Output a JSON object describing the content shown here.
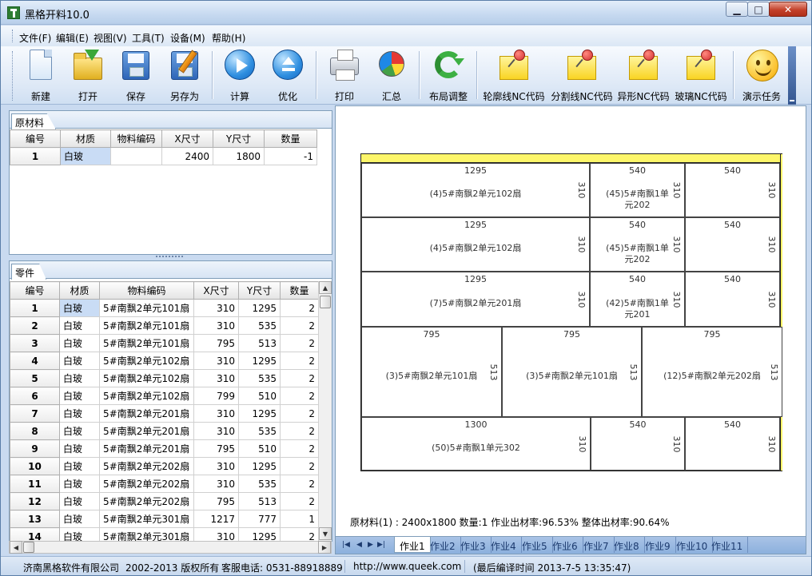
{
  "window": {
    "title": "黑格开料10.0"
  },
  "menu": [
    "文件(F)",
    "编辑(E)",
    "视图(V)",
    "工具(T)",
    "设备(M)",
    "帮助(H)"
  ],
  "toolbar": {
    "new": "新建",
    "open": "打开",
    "save": "保存",
    "save_as": "另存为",
    "compute": "计算",
    "optimize": "优化",
    "print": "打印",
    "summary": "汇总",
    "layout_adjust": "布局调整",
    "contour_nc": "轮廓线NC代码",
    "split_nc": "分割线NC代码",
    "shape_nc": "异形NC代码",
    "glass_nc": "玻璃NC代码",
    "demo_task": "演示任务"
  },
  "raw_panel": {
    "tab": "原材料",
    "headers": [
      "编号",
      "材质",
      "物料编码",
      "X尺寸",
      "Y尺寸",
      "数量"
    ],
    "rows": [
      {
        "id": "1",
        "material": "白玻",
        "code": "",
        "x": "2400",
        "y": "1800",
        "qty": "-1"
      }
    ]
  },
  "parts_panel": {
    "tab": "零件",
    "headers": [
      "编号",
      "材质",
      "物料编码",
      "X尺寸",
      "Y尺寸",
      "数量"
    ],
    "rows": [
      {
        "id": "1",
        "material": "白玻",
        "code": "5#南飘2单元101扇",
        "x": "310",
        "y": "1295",
        "qty": "2"
      },
      {
        "id": "2",
        "material": "白玻",
        "code": "5#南飘2单元101扇",
        "x": "310",
        "y": "535",
        "qty": "2"
      },
      {
        "id": "3",
        "material": "白玻",
        "code": "5#南飘2单元101扇",
        "x": "795",
        "y": "513",
        "qty": "2"
      },
      {
        "id": "4",
        "material": "白玻",
        "code": "5#南飘2单元102扇",
        "x": "310",
        "y": "1295",
        "qty": "2"
      },
      {
        "id": "5",
        "material": "白玻",
        "code": "5#南飘2单元102扇",
        "x": "310",
        "y": "535",
        "qty": "2"
      },
      {
        "id": "6",
        "material": "白玻",
        "code": "5#南飘2单元102扇",
        "x": "799",
        "y": "510",
        "qty": "2"
      },
      {
        "id": "7",
        "material": "白玻",
        "code": "5#南飘2单元201扇",
        "x": "310",
        "y": "1295",
        "qty": "2"
      },
      {
        "id": "8",
        "material": "白玻",
        "code": "5#南飘2单元201扇",
        "x": "310",
        "y": "535",
        "qty": "2"
      },
      {
        "id": "9",
        "material": "白玻",
        "code": "5#南飘2单元201扇",
        "x": "795",
        "y": "510",
        "qty": "2"
      },
      {
        "id": "10",
        "material": "白玻",
        "code": "5#南飘2单元202扇",
        "x": "310",
        "y": "1295",
        "qty": "2"
      },
      {
        "id": "11",
        "material": "白玻",
        "code": "5#南飘2单元202扇",
        "x": "310",
        "y": "535",
        "qty": "2"
      },
      {
        "id": "12",
        "material": "白玻",
        "code": "5#南飘2单元202扇",
        "x": "795",
        "y": "513",
        "qty": "2"
      },
      {
        "id": "13",
        "material": "白玻",
        "code": "5#南飘2单元301扇",
        "x": "1217",
        "y": "777",
        "qty": "1"
      },
      {
        "id": "14",
        "material": "白玻",
        "code": "5#南飘2单元301扇",
        "x": "310",
        "y": "1295",
        "qty": "2"
      }
    ]
  },
  "layout": {
    "parts": [
      {
        "w": "1295",
        "h": "310",
        "name": "(4)5#南飘2单元102扇"
      },
      {
        "w": "540",
        "h": "310",
        "name": "(45)5#南飘1单元202"
      },
      {
        "w": "540",
        "h": "310",
        "name": ""
      },
      {
        "w": "1295",
        "h": "310",
        "name": "(4)5#南飘2单元102扇"
      },
      {
        "w": "540",
        "h": "310",
        "name": "(45)5#南飘1单元202"
      },
      {
        "w": "540",
        "h": "310",
        "name": ""
      },
      {
        "w": "1295",
        "h": "310",
        "name": "(7)5#南飘2单元201扇"
      },
      {
        "w": "540",
        "h": "310",
        "name": "(42)5#南飘1单元201"
      },
      {
        "w": "540",
        "h": "310",
        "name": ""
      },
      {
        "w": "795",
        "h": "513",
        "name": "(3)5#南飘2单元101扇"
      },
      {
        "w": "795",
        "h": "513",
        "name": "(3)5#南飘2单元101扇"
      },
      {
        "w": "795",
        "h": "513",
        "name": "(12)5#南飘2单元202扇"
      },
      {
        "w": "1300",
        "h": "310",
        "name": "(50)5#南飘1单元302"
      },
      {
        "w": "540",
        "h": "310",
        "name": ""
      },
      {
        "w": "540",
        "h": "310",
        "name": ""
      }
    ],
    "status": "原材料(1) : 2400x1800  数量:1  作业出材率:96.53%  整体出材率:90.64%"
  },
  "jobs": [
    "作业1",
    "作业2",
    "作业3",
    "作业4",
    "作业5",
    "作业6",
    "作业7",
    "作业8",
    "作业9",
    "作业10",
    "作业11"
  ],
  "statusbar": {
    "company": "济南黑格软件有限公司",
    "copyright": "2002-2013 版权所有",
    "phone": "客服电话: 0531-88918889",
    "url": "http://www.queek.com",
    "build": "(最后编译时间 2013-7-5 13:35:47)"
  }
}
